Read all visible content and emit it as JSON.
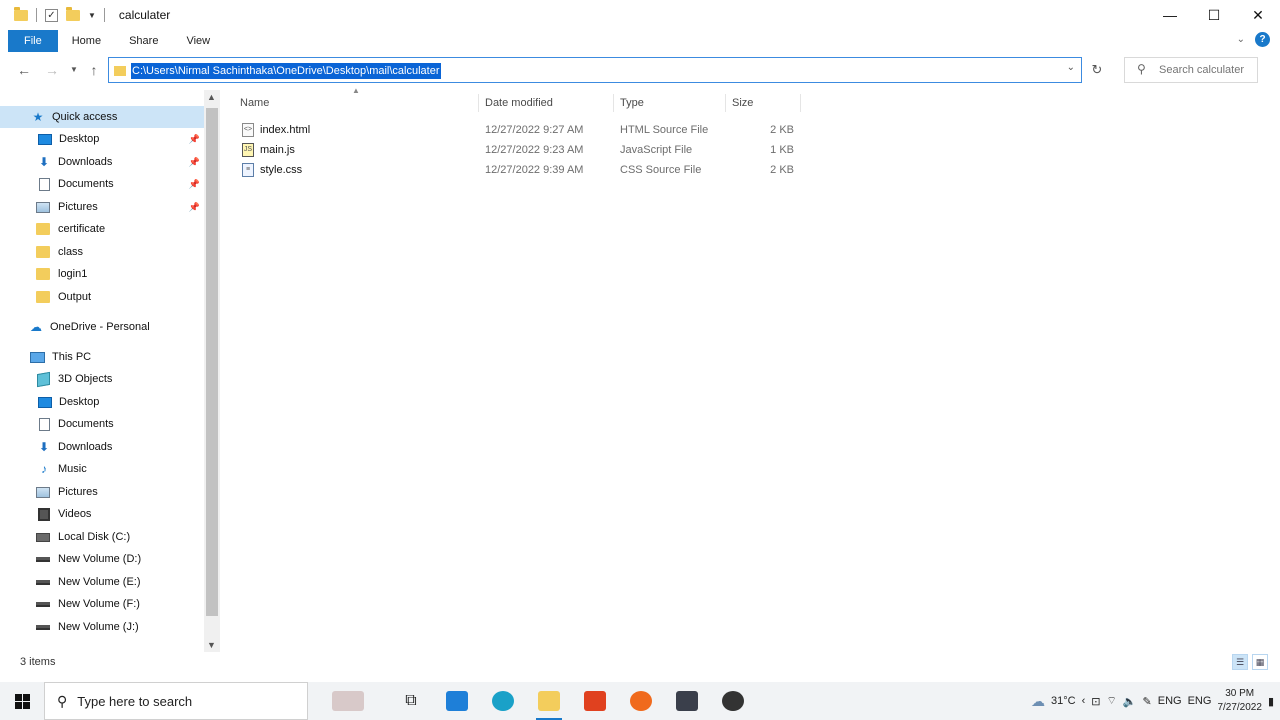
{
  "window": {
    "title": "calculater",
    "controls": {
      "minimize": "—",
      "maximize": "☐",
      "close": "✕"
    }
  },
  "ribbon": {
    "tabs": [
      "File",
      "Home",
      "Share",
      "View"
    ]
  },
  "address": {
    "path": "C:\\Users\\Nirmal Sachinthaka\\OneDrive\\Desktop\\mail\\calculater"
  },
  "search": {
    "placeholder": "Search calculater"
  },
  "nav": {
    "quick_access": "Quick access",
    "items_quick": [
      "Desktop",
      "Downloads",
      "Documents",
      "Pictures",
      "certificate",
      "class",
      "login1",
      "Output"
    ],
    "onedrive": "OneDrive - Personal",
    "this_pc": "This PC",
    "items_pc": [
      "3D Objects",
      "Desktop",
      "Documents",
      "Downloads",
      "Music",
      "Pictures",
      "Videos",
      "Local Disk (C:)",
      "New Volume (D:)",
      "New Volume (E:)",
      "New Volume (F:)",
      "New Volume (J:)"
    ]
  },
  "columns": {
    "name": "Name",
    "date": "Date modified",
    "type": "Type",
    "size": "Size"
  },
  "files": [
    {
      "name": "index.html",
      "date": "12/27/2022 9:27 AM",
      "type": "HTML Source File",
      "size": "2 KB"
    },
    {
      "name": "main.js",
      "date": "12/27/2022 9:23 AM",
      "type": "JavaScript File",
      "size": "1 KB"
    },
    {
      "name": "style.css",
      "date": "12/27/2022 9:39 AM",
      "type": "CSS Source File",
      "size": "2 KB"
    }
  ],
  "status": {
    "count": "3 items"
  },
  "taskbar": {
    "search_text": "Type here to search",
    "weather": "31°C",
    "lang1": "ENG",
    "lang2": "ENG",
    "time": "30 PM",
    "date": "7/27/2022"
  },
  "colors": {
    "accent": "#1979ca",
    "selection": "#0a64d6",
    "folder": "#f3cd5c"
  }
}
